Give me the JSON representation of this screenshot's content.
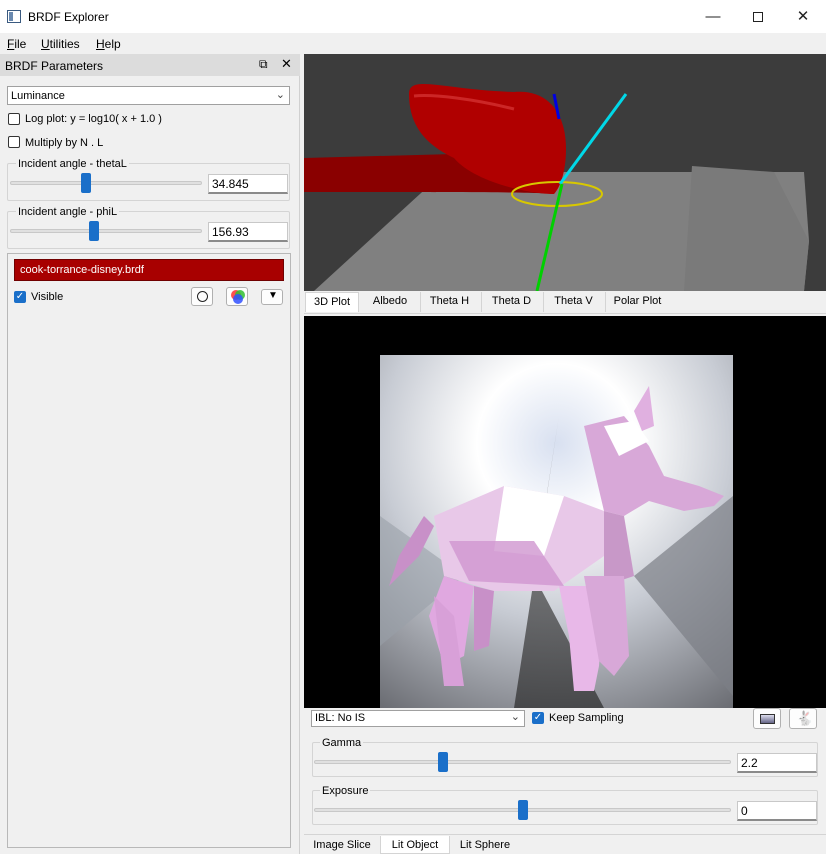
{
  "window": {
    "title": "BRDF Explorer",
    "minimize_icon": "minimize-icon",
    "maximize_icon": "maximize-icon",
    "close_icon": "close-icon"
  },
  "menu": [
    {
      "label": "File",
      "accel": "F",
      "rest": "ile"
    },
    {
      "label": "Utilities",
      "accel": "U",
      "rest": "tilities"
    },
    {
      "label": "Help",
      "accel": "H",
      "rest": "elp"
    }
  ],
  "params": {
    "dock_title": "BRDF Parameters",
    "mode": "Luminance",
    "log_plot": {
      "label": "Log plot:  y = log10( x + 1.0 )",
      "checked": false
    },
    "multiply": {
      "label": "Multiply by N . L",
      "checked": false
    },
    "theta": {
      "label": "Incident angle - thetaL",
      "value": "34.845",
      "fraction": 0.392
    },
    "phi": {
      "label": "Incident angle - phiL",
      "value": "156.93",
      "fraction": 0.436
    }
  },
  "brdf": {
    "name": "cook-torrance-disney.brdf",
    "visible_label": "Visible",
    "visible": true,
    "color": "#a80000"
  },
  "top_tabs": [
    {
      "label": "3D Plot",
      "active": true
    },
    {
      "label": "Albedo",
      "active": false
    },
    {
      "label": "Theta H",
      "active": false
    },
    {
      "label": "Theta D",
      "active": false
    },
    {
      "label": "Theta V",
      "active": false
    },
    {
      "label": "Polar Plot",
      "active": false
    }
  ],
  "lit": {
    "ibl_mode": "IBL: No IS",
    "keep_sampling_label": "Keep Sampling",
    "keep_sampling": true,
    "gamma": {
      "label": "Gamma",
      "value": "2.2",
      "fraction": 0.305
    },
    "exposure": {
      "label": "Exposure",
      "value": "0",
      "fraction": 0.5
    }
  },
  "bottom_tabs": [
    {
      "label": "Image Slice",
      "active": false
    },
    {
      "label": "Lit Object",
      "active": true
    },
    {
      "label": "Lit Sphere",
      "active": false
    }
  ],
  "colors": {
    "accent": "#1a6fc9",
    "brdf_red": "#a80000"
  }
}
